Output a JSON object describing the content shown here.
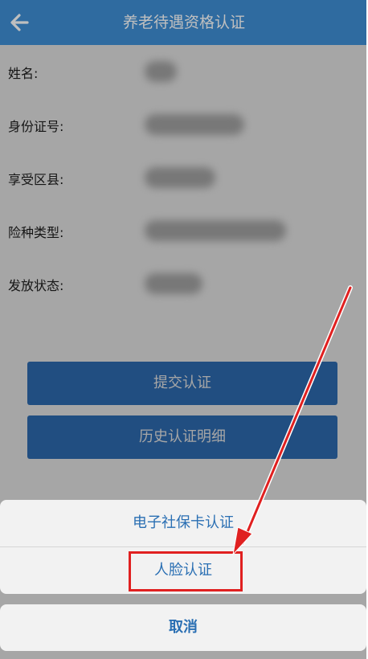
{
  "header": {
    "title": "养老待遇资格认证",
    "back_icon": "arrow-left-icon"
  },
  "form": {
    "fields": [
      {
        "label": "姓名:"
      },
      {
        "label": "身份证号:"
      },
      {
        "label": "享受区县:"
      },
      {
        "label": "险种类型:"
      },
      {
        "label": "发放状态:"
      }
    ]
  },
  "buttons": {
    "submit": "提交认证",
    "history": "历史认证明细"
  },
  "action_sheet": {
    "options": [
      "电子社保卡认证",
      "人脸认证"
    ],
    "cancel": "取消"
  },
  "colors": {
    "header_bg": "#3f8fd6",
    "button_bg": "#3478c6",
    "sheet_text": "#2a6fb3",
    "annotation_red": "#e02020"
  }
}
